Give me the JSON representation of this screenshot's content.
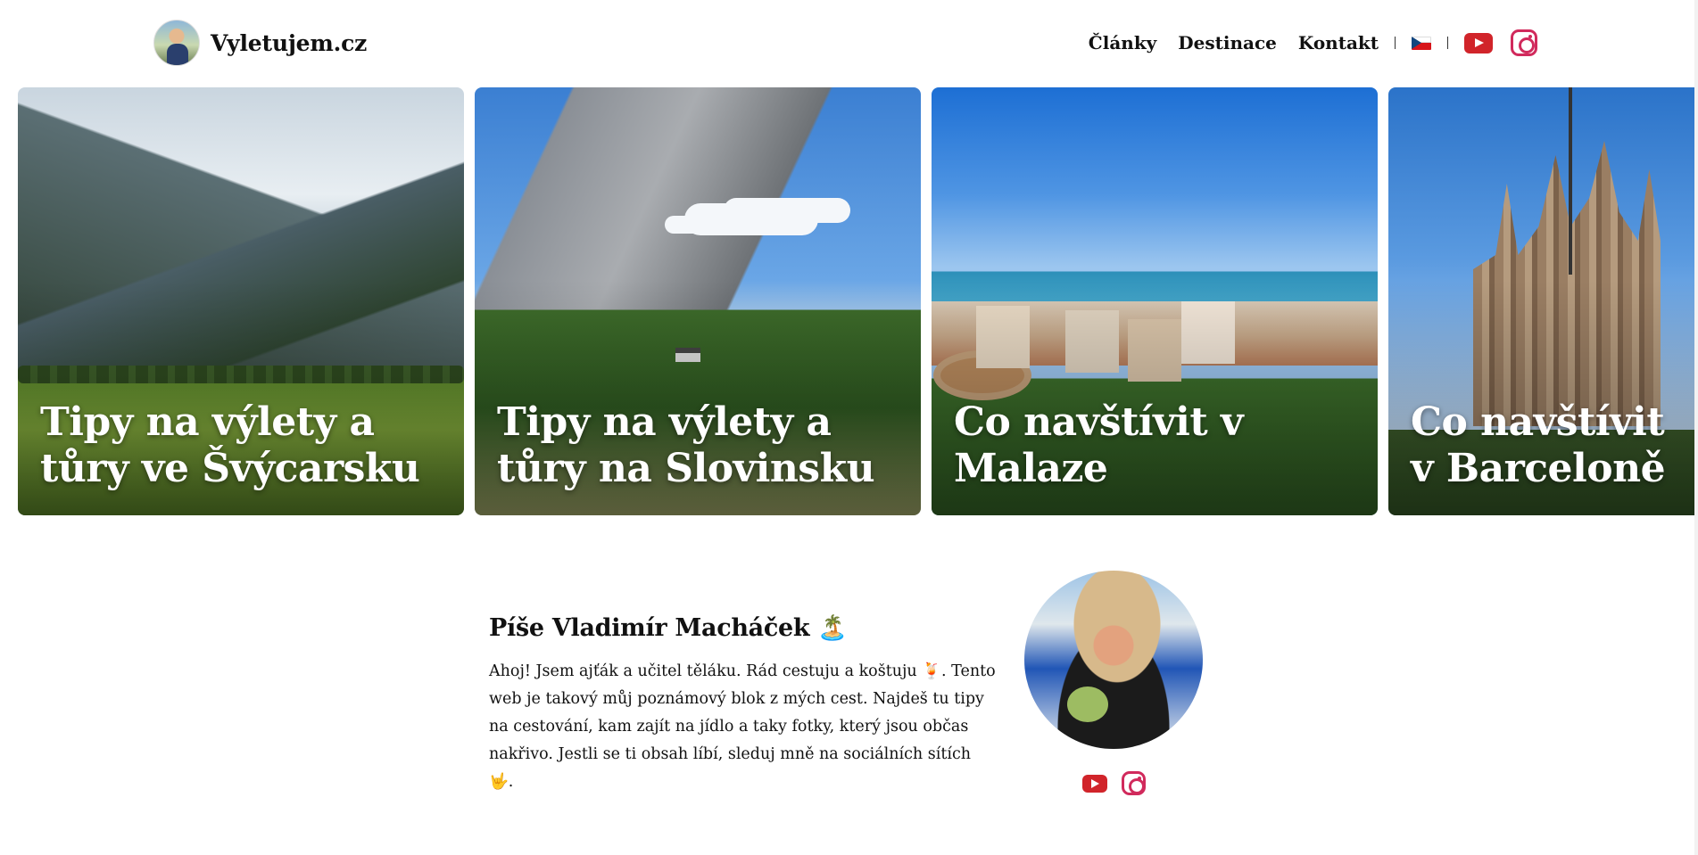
{
  "header": {
    "site_name": "Vyletujem.cz",
    "nav": [
      {
        "label": "Články"
      },
      {
        "label": "Destinace"
      },
      {
        "label": "Kontakt"
      }
    ],
    "language_flag": "czech-flag-icon",
    "social": [
      "youtube-icon",
      "instagram-icon"
    ]
  },
  "cards": [
    {
      "title": "Tipy na výlety a tůry ve Švýcarsku"
    },
    {
      "title": "Tipy na výlety a tůry na Slovinsku"
    },
    {
      "title": "Co navštívit v Malaze"
    },
    {
      "title": "Co navštívit v Barceloně"
    }
  ],
  "about": {
    "heading": "Píše Vladimír Macháček 🏝️",
    "text": "Ahoj! Jsem ajťák a učitel těláku. Rád cestuju a koštuju 🍹. Tento web je takový můj poznámový blok z mých cest. Najdeš tu tipy na cestování, kam zajít na jídlo a taky fotky, který jsou občas nakřivo. Jestli se ti obsah líbí, sleduj mně na sociálních sítích 🤟.",
    "social": [
      "youtube-icon",
      "instagram-icon"
    ]
  },
  "colors": {
    "youtube": "#d1242a",
    "instagram": "#d12a5c",
    "text": "#111111"
  }
}
